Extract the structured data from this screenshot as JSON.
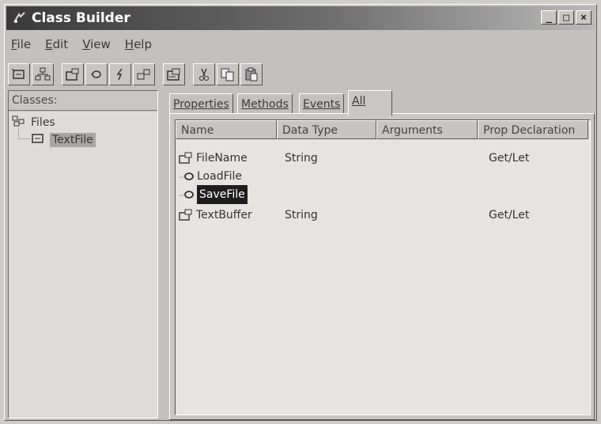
{
  "window": {
    "title": "Class Builder"
  },
  "menu": [
    {
      "label": "File"
    },
    {
      "label": "Edit"
    },
    {
      "label": "View"
    },
    {
      "label": "Help"
    }
  ],
  "toolbar": {
    "buttons": [
      {
        "name": "add-class-button",
        "icon": "class-icon"
      },
      {
        "name": "add-collection-button",
        "icon": "collection-icon"
      },
      {
        "name": "add-property-button",
        "icon": "property-icon"
      },
      {
        "name": "add-method-button",
        "icon": "method-icon"
      },
      {
        "name": "add-event-button",
        "icon": "event-icon"
      },
      {
        "name": "add-enum-button",
        "icon": "enum-icon"
      },
      {
        "name": "properties-button",
        "icon": "properties-icon"
      },
      {
        "name": "cut-button",
        "icon": "scissors-icon"
      },
      {
        "name": "copy-button",
        "icon": "copy-icon"
      },
      {
        "name": "paste-button",
        "icon": "paste-icon"
      }
    ]
  },
  "classes_pane": {
    "header": "Classes:",
    "tree": [
      {
        "label": "Files",
        "icon": "project-icon"
      },
      {
        "label": "TextFile",
        "icon": "class-icon",
        "selected": true
      }
    ]
  },
  "tabs": [
    {
      "label": "Properties"
    },
    {
      "label": "Methods"
    },
    {
      "label": "Events"
    },
    {
      "label": "All",
      "active": true
    }
  ],
  "list": {
    "columns": [
      "Name",
      "Data Type",
      "Arguments",
      "Prop Declaration"
    ],
    "rows": [
      {
        "name": "FileName",
        "data_type": "String",
        "arguments": "",
        "prop_declaration": "Get/Let",
        "icon": "property-icon"
      },
      {
        "name": "LoadFile",
        "data_type": "",
        "arguments": "",
        "prop_declaration": "",
        "icon": "method-icon"
      },
      {
        "name": "SaveFile",
        "data_type": "",
        "arguments": "",
        "prop_declaration": "",
        "icon": "method-icon",
        "selected": true
      },
      {
        "name": "TextBuffer",
        "data_type": "String",
        "arguments": "",
        "prop_declaration": "Get/Let",
        "icon": "property-icon"
      }
    ]
  }
}
